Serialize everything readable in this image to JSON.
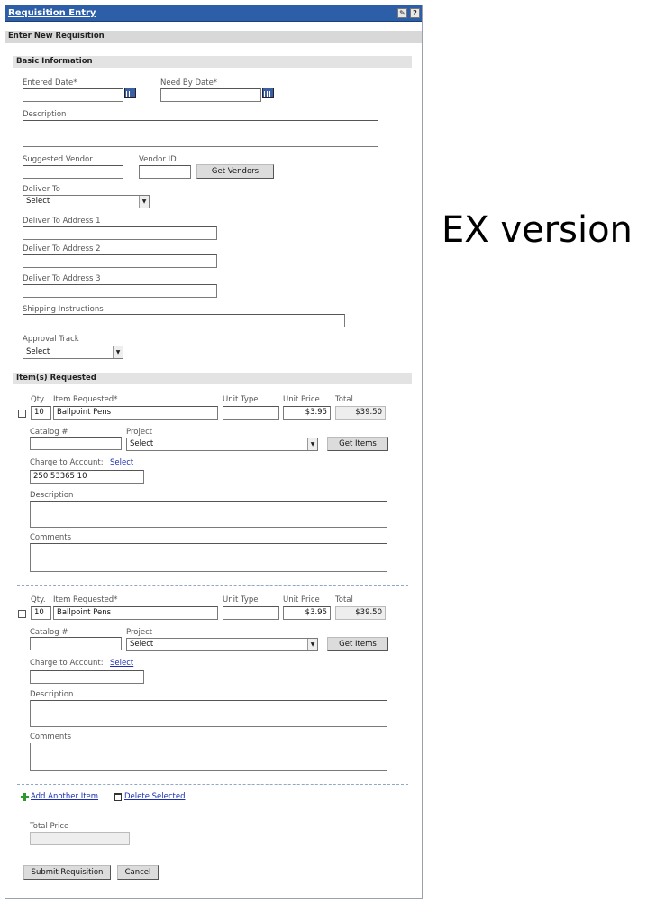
{
  "window": {
    "title": "Requisition Entry",
    "icon_help": "?"
  },
  "form_header": "Enter New Requisition",
  "basic": {
    "section": "Basic Information",
    "entered_date": "Entered Date*",
    "need_by_date": "Need By Date*",
    "description": "Description",
    "suggested_vendor": "Suggested Vendor",
    "vendor_id": "Vendor ID",
    "get_vendors": "Get Vendors",
    "deliver_to": "Deliver To",
    "deliver_to_value": "Select",
    "addr1": "Deliver To Address 1",
    "addr2": "Deliver To Address 2",
    "addr3": "Deliver To Address 3",
    "shipping": "Shipping Instructions",
    "approval": "Approval Track",
    "approval_value": "Select"
  },
  "items_section": "Item(s) Requested",
  "item_labels": {
    "qty": "Qty.",
    "item": "Item Requested*",
    "unit_type": "Unit Type",
    "unit_price": "Unit Price",
    "total": "Total",
    "catalog": "Catalog #",
    "project": "Project",
    "get_items": "Get Items",
    "charge": "Charge to Account:",
    "select_link": "Select",
    "description": "Description",
    "comments": "Comments"
  },
  "items": [
    {
      "qty": "10",
      "item": "Ballpoint Pens",
      "unit_price": "$3.95",
      "total": "$39.50",
      "project": "Select",
      "account": "250 53365 10"
    },
    {
      "qty": "10",
      "item": "Ballpoint Pens",
      "unit_price": "$3.95",
      "total": "$39.50",
      "project": "Select",
      "account": ""
    }
  ],
  "actions": {
    "add_item": "Add Another Item",
    "delete_selected": "Delete Selected",
    "total_price": "Total Price",
    "submit": "Submit Requisition",
    "cancel": "Cancel"
  },
  "side_note": "EX version"
}
